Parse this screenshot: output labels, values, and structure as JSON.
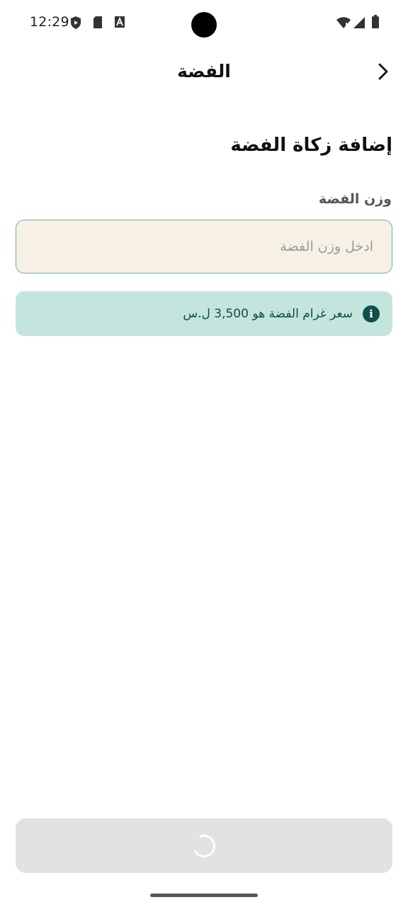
{
  "status_bar": {
    "time": "12:29",
    "icons": [
      "shield-play-icon",
      "sd-card-icon",
      "font-a-icon",
      "wifi-icon",
      "signal-icon",
      "battery-icon"
    ]
  },
  "app_bar": {
    "title": "الفضة",
    "back_icon": "chevron-right-icon"
  },
  "form": {
    "heading": "إضافة زكاة الفضة",
    "weight_label": "وزن الفضة",
    "weight_placeholder": "ادخل وزن الفضة",
    "weight_value": ""
  },
  "info_banner": {
    "icon": "info-icon",
    "icon_glyph": "i",
    "text": "سعر غرام الفضة هو 3,500 ل.س"
  },
  "submit_button": {
    "state": "loading",
    "icon": "spinner-icon"
  },
  "colors": {
    "input_bg": "#f6f0e5",
    "input_border": "#6cb0a3",
    "info_bg": "#c4e4de",
    "info_text": "#0e4f4a",
    "button_bg": "#e2e2e2"
  }
}
